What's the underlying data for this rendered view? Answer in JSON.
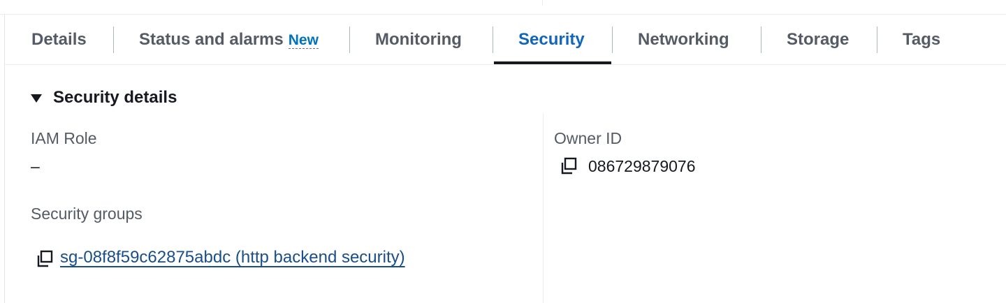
{
  "tabs": [
    {
      "label": "Details"
    },
    {
      "label": "Status and alarms",
      "badge": "New"
    },
    {
      "label": "Monitoring"
    },
    {
      "label": "Security"
    },
    {
      "label": "Networking"
    },
    {
      "label": "Storage"
    },
    {
      "label": "Tags"
    }
  ],
  "active_tab": "Security",
  "section": {
    "title": "Security details",
    "expanded": true,
    "caret_icon": "caret-down-icon"
  },
  "fields": {
    "iam_role": {
      "label": "IAM Role",
      "value": "–"
    },
    "security_groups": {
      "label": "Security groups",
      "items": [
        {
          "text": "sg-08f8f59c62875abdc (http backend security)",
          "icon": "copy-icon"
        }
      ]
    },
    "owner_id": {
      "label": "Owner ID",
      "value": "086729879076",
      "icon": "copy-icon"
    }
  },
  "colors": {
    "active_tab_text": "#1166bb",
    "link": "#1a4e8a",
    "badge": "#0073bb"
  }
}
